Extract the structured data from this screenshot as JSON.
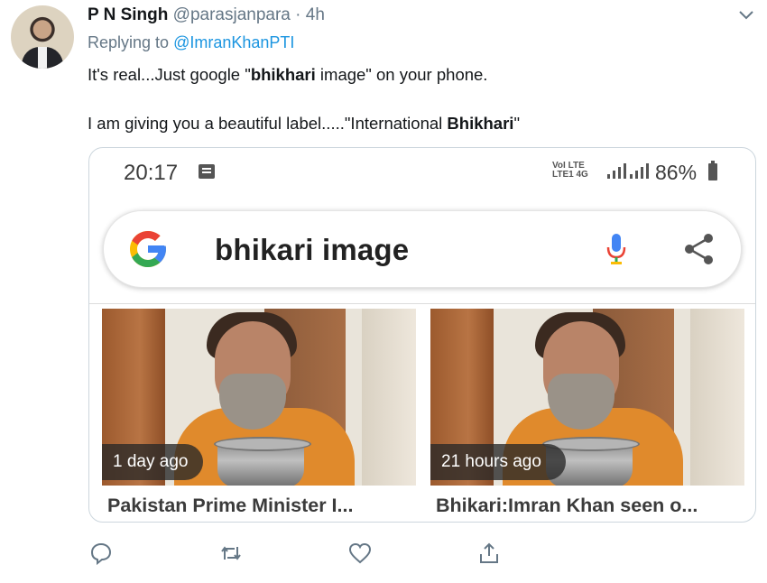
{
  "tweet": {
    "author_name": "P N Singh",
    "author_handle": "@parasjanpara",
    "separator": "·",
    "time": "4h",
    "replying_prefix": "Replying to ",
    "replying_to": "@ImranKhanPTI",
    "line1_pre": "It's real...Just google \"",
    "line1_bold": "bhikhari",
    "line1_post": " image\" on your phone.",
    "line2_pre": "I am giving you a beautiful label.....\"International ",
    "line2_bold": "Bhikhari",
    "line2_post": "\""
  },
  "screenshot": {
    "clock": "20:17",
    "network_label": "Vo) LTE\nLTE1 4G",
    "battery": "86%",
    "search_query": "bhikari image",
    "results": [
      {
        "age": "1 day ago",
        "caption": "Pakistan Prime Minister I..."
      },
      {
        "age": "21 hours ago",
        "caption": "Bhikari:Imran Khan seen o..."
      }
    ]
  },
  "colors": {
    "link": "#1b95e0",
    "muted": "#657786",
    "google_blue": "#4285F4",
    "google_red": "#EA4335",
    "google_yellow": "#FBBC05",
    "google_green": "#34A853"
  },
  "icons": [
    "chevron-down-icon",
    "google-logo-icon",
    "mic-icon",
    "share-icon",
    "reply-icon",
    "retweet-icon",
    "like-icon",
    "share-tweet-icon"
  ]
}
